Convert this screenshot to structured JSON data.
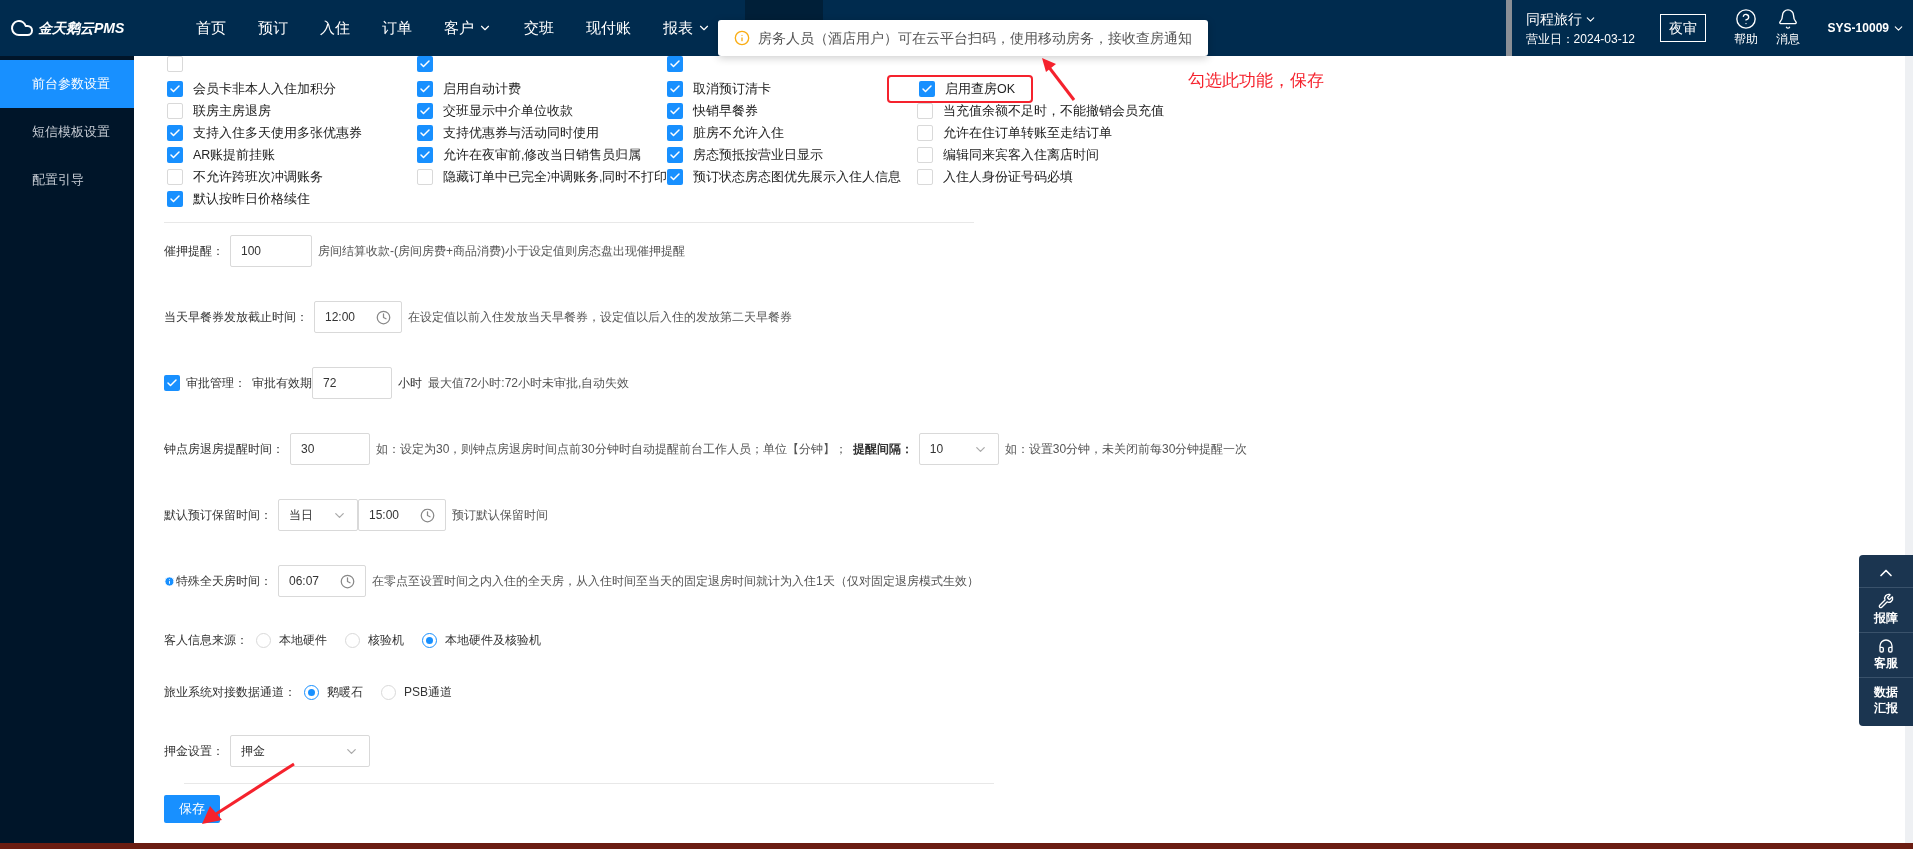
{
  "header": {
    "logo": "金天鹅云PMS",
    "nav": [
      {
        "label": "首页",
        "dropdown": false,
        "selected": false
      },
      {
        "label": "预订",
        "dropdown": false,
        "selected": false
      },
      {
        "label": "入住",
        "dropdown": false,
        "selected": false
      },
      {
        "label": "订单",
        "dropdown": false,
        "selected": false
      },
      {
        "label": "客户",
        "dropdown": true,
        "selected": false
      },
      {
        "label": "交班",
        "dropdown": false,
        "selected": false
      },
      {
        "label": "现付账",
        "dropdown": false,
        "selected": false
      },
      {
        "label": "报表",
        "dropdown": true,
        "selected": false
      },
      {
        "kind": "hidden",
        "selected": true
      }
    ],
    "hotel": "同程旅行",
    "business_date": "营业日：2024-03-12",
    "night_audit": "夜审",
    "help": "帮助",
    "messages": "消息",
    "user": "SYS-10009"
  },
  "sidebar": {
    "items": [
      {
        "label": "前台参数设置",
        "selected": true
      },
      {
        "label": "短信模板设置",
        "selected": false
      },
      {
        "label": "配置引导",
        "selected": false
      }
    ]
  },
  "popup": {
    "text": "房务人员（酒店用户）可在云平台扫码，使用移动房务，接收查房通知"
  },
  "annotation": {
    "text": "勾选此功能，保存"
  },
  "checkbox_rows": [
    [
      {
        "kind": "partial",
        "checked": false
      },
      {
        "kind": "partial",
        "checked": true
      },
      {
        "kind": "partial",
        "checked": true
      },
      {
        "kind": "blank"
      }
    ],
    [
      {
        "kind": "checkbox",
        "label": "会员卡非本人入住加积分",
        "checked": true
      },
      {
        "kind": "checkbox",
        "label": "启用自动计费",
        "checked": true
      },
      {
        "kind": "checkbox",
        "label": "取消预订清卡",
        "checked": true
      },
      {
        "kind": "highlighted",
        "label": "启用查房OK",
        "checked": true
      }
    ],
    [
      {
        "kind": "checkbox",
        "label": "联房主房退房",
        "checked": false
      },
      {
        "kind": "checkbox",
        "label": "交班显示中介单位收款",
        "checked": true
      },
      {
        "kind": "checkbox",
        "label": "快销早餐券",
        "checked": true
      },
      {
        "kind": "checkbox",
        "label": "当充值余额不足时，不能撤销会员充值",
        "checked": false
      }
    ],
    [
      {
        "kind": "checkbox",
        "label": "支持入住多天使用多张优惠券",
        "checked": true
      },
      {
        "kind": "checkbox",
        "label": "支持优惠券与活动同时使用",
        "checked": true
      },
      {
        "kind": "checkbox",
        "label": "脏房不允许入住",
        "checked": true
      },
      {
        "kind": "checkbox",
        "label": "允许在住订单转账至走结订单",
        "checked": false
      }
    ],
    [
      {
        "kind": "checkbox",
        "label": "AR账提前挂账",
        "checked": true
      },
      {
        "kind": "checkbox",
        "label": "允许在夜审前,修改当日销售员归属",
        "checked": true
      },
      {
        "kind": "checkbox",
        "label": "房态预抵按营业日显示",
        "checked": true
      },
      {
        "kind": "checkbox",
        "label": "编辑同来宾客入住离店时间",
        "checked": false
      }
    ],
    [
      {
        "kind": "checkbox",
        "label": "不允许跨班次冲调账务",
        "checked": false
      },
      {
        "kind": "checkbox",
        "label": "隐藏订单中已完全冲调账务,同时不打印",
        "checked": false
      },
      {
        "kind": "checkbox",
        "label": "预订状态房态图优先展示入住人信息",
        "checked": true
      },
      {
        "kind": "checkbox",
        "label": "入住人身份证号码必填",
        "checked": false
      }
    ],
    [
      {
        "kind": "checkbox",
        "label": "默认按昨日价格续住",
        "checked": true
      },
      {
        "kind": "blank"
      },
      {
        "kind": "blank"
      },
      {
        "kind": "blank"
      }
    ]
  ],
  "settings": [
    {
      "kind": "input",
      "label": "催押提醒：",
      "value": "100",
      "hint": "房间结算收款-(房间房费+商品消费)小于设定值则房态盘出现催押提醒"
    },
    {
      "kind": "time",
      "label": "当天早餐券发放截止时间：",
      "value": "12:00",
      "hint": "在设定值以前入住发放当天早餐券，设定值以后入住的发放第二天早餐券"
    },
    {
      "kind": "approval",
      "checked": true,
      "label": "审批管理：",
      "sublabel": "审批有效期",
      "value": "72",
      "unit": "小时",
      "hint": "最大值72小时:72小时未审批,自动失效"
    },
    {
      "kind": "hourly",
      "label": "钟点房退房提醒时间：",
      "value": "30",
      "hint": "如：设定为30，则钟点房退房时间点前30分钟时自动提醒前台工作人员；单位【分钟】；",
      "label2": "提醒间隔：",
      "select": "10",
      "hint2": "如：设置30分钟，未关闭前每30分钟提醒一次"
    },
    {
      "kind": "reserve",
      "label": "默认预订保留时间：",
      "select": "当日",
      "value": "15:00",
      "hint": "预订默认保留时间"
    },
    {
      "kind": "special",
      "label": "特殊全天房时间：",
      "value": "06:07",
      "hint": "在零点至设置时间之内入住的全天房，从入住时间至当天的固定退房时间就计为入住1天（仅对固定退房模式生效）"
    },
    {
      "kind": "radio",
      "label": "客人信息来源：",
      "options": [
        {
          "label": "本地硬件",
          "selected": false
        },
        {
          "label": "核验机",
          "selected": false
        },
        {
          "label": "本地硬件及核验机",
          "selected": true
        }
      ]
    },
    {
      "kind": "radio",
      "label": "旅业系统对接数据通道：",
      "options": [
        {
          "label": "鹅暖石",
          "selected": true
        },
        {
          "label": "PSB通道",
          "selected": false
        }
      ]
    },
    {
      "kind": "select",
      "label": "押金设置：",
      "value": "押金"
    }
  ],
  "save_button": "保存",
  "float_panel": {
    "items": [
      {
        "kind": "up"
      },
      {
        "kind": "wrench",
        "label": "报障"
      },
      {
        "kind": "headset",
        "label": "客服"
      },
      {
        "kind": "text",
        "label": "数据汇报"
      }
    ]
  }
}
